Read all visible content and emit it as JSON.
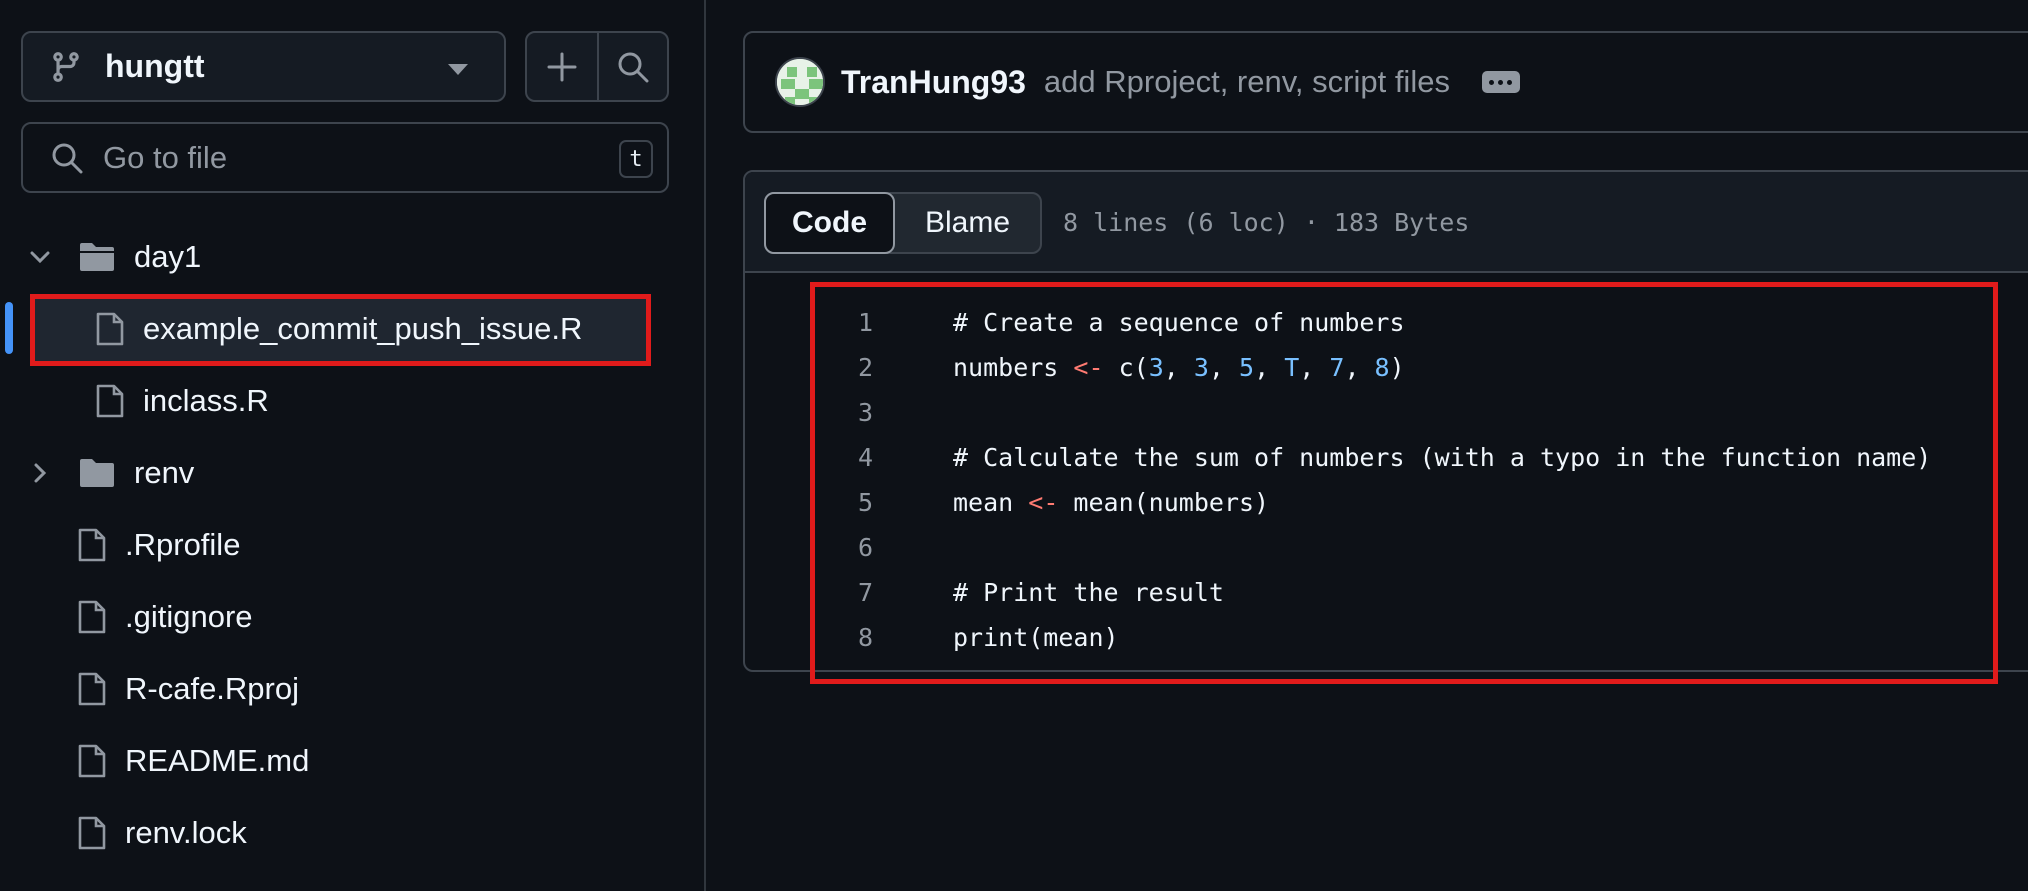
{
  "sidebar": {
    "branch": "hungtt",
    "search_placeholder": "Go to file",
    "search_shortcut": "t",
    "tree": [
      {
        "label": "day1",
        "type": "folder",
        "expanded": true,
        "depth": 0
      },
      {
        "label": "example_commit_push_issue.R",
        "type": "file",
        "depth": 1,
        "selected": true
      },
      {
        "label": "inclass.R",
        "type": "file",
        "depth": 1
      },
      {
        "label": "renv",
        "type": "folder",
        "expanded": false,
        "depth": 0
      },
      {
        "label": ".Rprofile",
        "type": "file",
        "depth": 0
      },
      {
        "label": ".gitignore",
        "type": "file",
        "depth": 0
      },
      {
        "label": "R-cafe.Rproj",
        "type": "file",
        "depth": 0
      },
      {
        "label": "README.md",
        "type": "file",
        "depth": 0
      },
      {
        "label": "renv.lock",
        "type": "file",
        "depth": 0
      }
    ]
  },
  "commit": {
    "author": "TranHung93",
    "message": "add Rproject, renv, script files"
  },
  "file_view": {
    "tab_code": "Code",
    "tab_blame": "Blame",
    "meta": "8 lines (6 loc) · 183 Bytes",
    "lines": [
      "# Create a sequence of numbers",
      "numbers <- c(3, 3, 5, T, 7, 8)",
      "",
      "# Calculate the sum of numbers (with a typo in the function name)",
      "mean <- mean(numbers)",
      "",
      "# Print the result",
      "print(mean)"
    ]
  },
  "colors": {
    "background": "#0d1117",
    "accent": "#4493f8",
    "highlight_box": "#e01b1b",
    "comment": "#9198a1",
    "operator": "#ff7b72",
    "number": "#79c0ff"
  }
}
